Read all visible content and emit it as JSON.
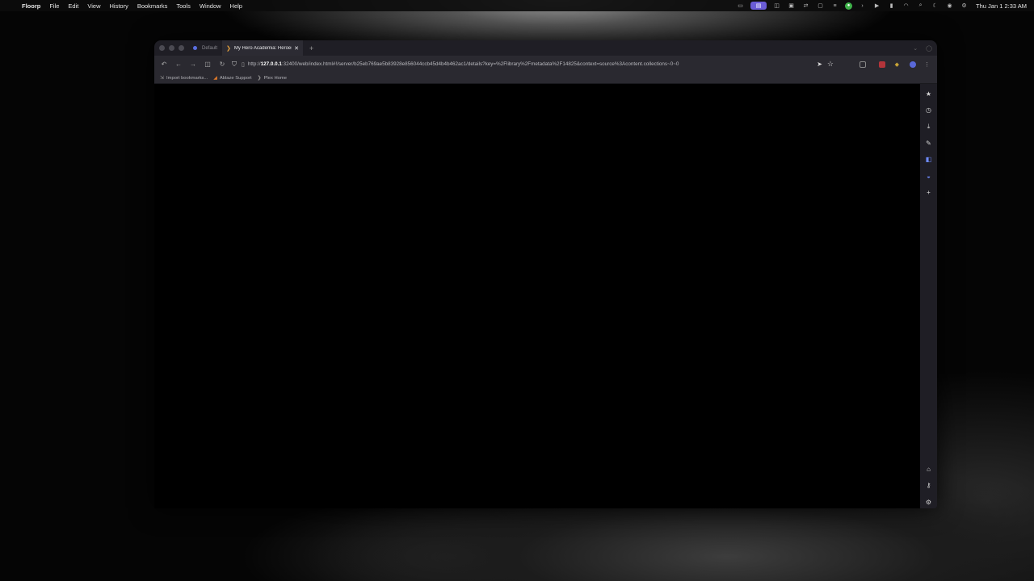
{
  "menubar": {
    "app": "Floorp",
    "items": [
      "File",
      "Edit",
      "View",
      "History",
      "Bookmarks",
      "Tools",
      "Window",
      "Help"
    ],
    "clock": "Thu Jan 1  2:33 AM"
  },
  "tabs": {
    "container": "Default",
    "active_title": "My Hero Academia: Heroes Rising",
    "new_tab": "+"
  },
  "url": {
    "prefix": "http://",
    "host": "127.0.0.1",
    "rest": ":32400/web/index.html#!/server/b25eb769ae5b83928e856044ccb45d4b4b462ac1/details?key=%2Flibrary%2Fmetadata%2F14825&context=source%3Acontent.collections~0~0"
  },
  "bookmarks": [
    {
      "label": "Import bookmarks..."
    },
    {
      "label": "Ablaze Support"
    },
    {
      "label": "Plex Home"
    }
  ],
  "colors": {
    "accent": "#6a5cd6",
    "chrome": "#1f1e25",
    "tab_active": "#2c2b33"
  }
}
